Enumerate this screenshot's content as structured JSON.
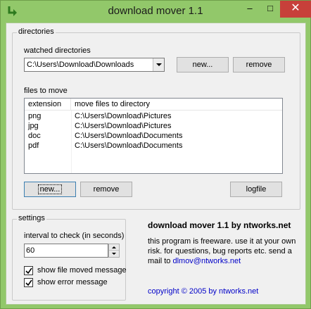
{
  "window": {
    "title": "download mover 1.1",
    "controls": {
      "minimize": "–",
      "maximize": "□",
      "close": "✕"
    }
  },
  "directories": {
    "group_label": "directories",
    "watched_label": "watched directories",
    "watched_selected": "C:\\Users\\Download\\Downloads",
    "new_button": "new...",
    "remove_button": "remove"
  },
  "files": {
    "label": "files to move",
    "columns": [
      "extension",
      "move files to directory"
    ],
    "rows": [
      {
        "extension": "png",
        "directory": "C:\\Users\\Download\\Pictures"
      },
      {
        "extension": "jpg",
        "directory": "C:\\Users\\Download\\Pictures"
      },
      {
        "extension": "doc",
        "directory": "C:\\Users\\Download\\Documents"
      },
      {
        "extension": "pdf",
        "directory": "C:\\Users\\Download\\Documents"
      }
    ],
    "new_button": "new...",
    "remove_button": "remove",
    "logfile_button": "logfile"
  },
  "settings": {
    "group_label": "settings",
    "interval_label": "interval to check (in seconds)",
    "interval_value": "60",
    "show_moved_label": "show file moved message",
    "show_moved_checked": true,
    "show_error_label": "show error message",
    "show_error_checked": true
  },
  "about": {
    "title": "download mover 1.1 by ntworks.net",
    "line1": "this program is freeware. use it at your own",
    "line2": "risk. for questions, bug reports etc. send a",
    "line3_prefix": "mail to",
    "email": "dlmov@ntworks.net",
    "copyright": "copyright © 2005 by ntworks.net"
  },
  "colors": {
    "frame": "#92c86a",
    "close": "#c7403a",
    "link": "#0000c8",
    "client": "#f0f0f0"
  },
  "icons": {
    "app": "download-arrow-icon",
    "check": "check-icon"
  }
}
